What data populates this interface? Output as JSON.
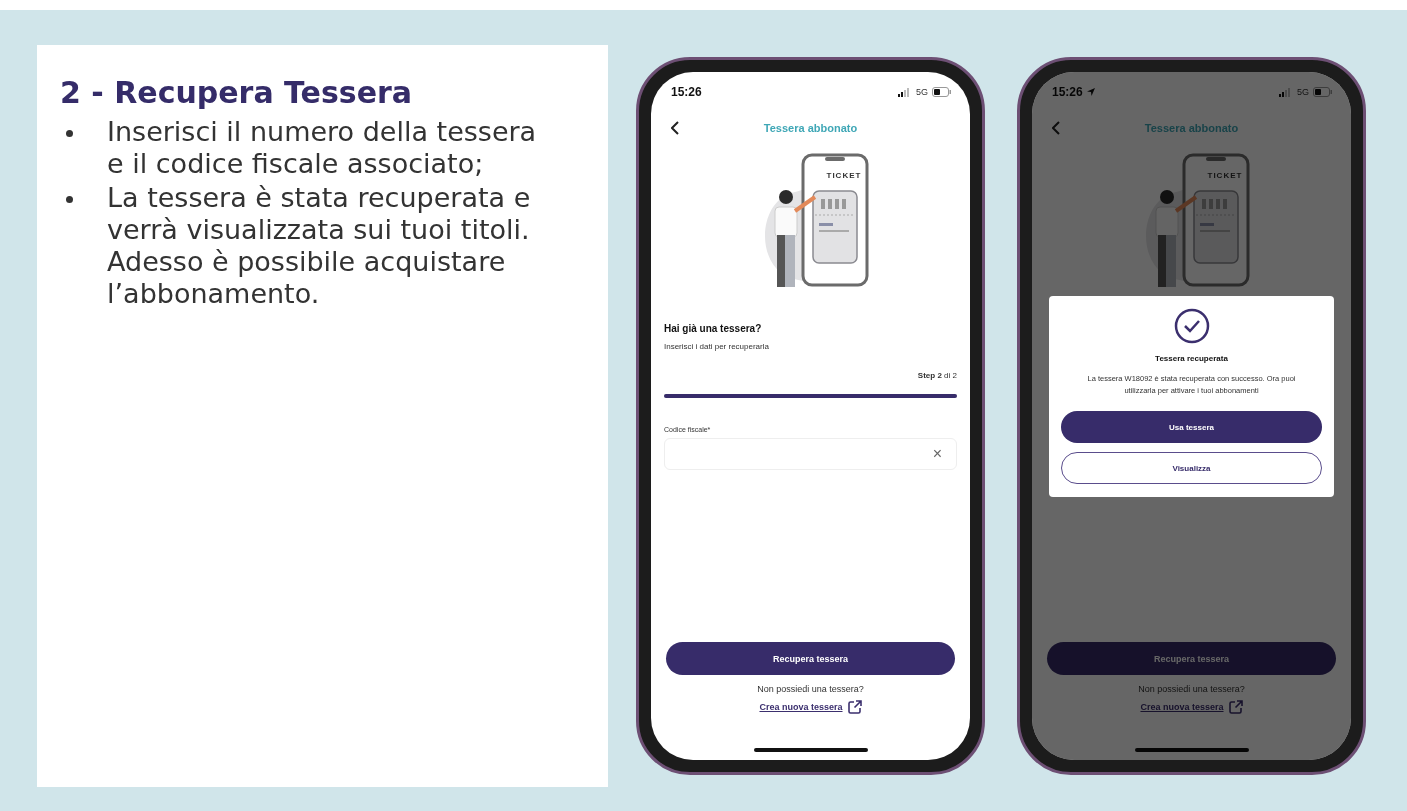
{
  "slide": {
    "title": "2 - Recupera Tessera",
    "bullets": [
      "Inserisci il numero della tessera e il codice fiscale associato;",
      "La tessera è stata recuperata e verrà visualizzata sui tuoi titoli. Adesso è possibile acquistare l’abbonamento."
    ]
  },
  "phones": [
    {
      "time": "15:26",
      "location": false,
      "network": "5G",
      "dimmed": false,
      "header_title": "Tessera abbonato",
      "ticket_label": "TICKET",
      "heading": "Hai già una tessera?",
      "subtitle": "Inserisci i dati per recuperarla",
      "step": "**Step 2** di 2",
      "progress": {
        "level": 1
      },
      "field": {
        "label": "Codice fiscale*",
        "clear": "×"
      },
      "primary_button": "Recupera tessera",
      "question": "Non possiedi una tessera?",
      "link": "Crea nuova tessera"
    },
    {
      "time": "15:26",
      "location": true,
      "network": "5G",
      "dimmed": true,
      "header_title": "Tessera abbonato",
      "ticket_label": "TICKET",
      "primary_button": "Recupera tessera",
      "question": "Non possiedi una tessera?",
      "link": "Crea nuova tessera",
      "dialog": {
        "title": "Tessera recuperata",
        "body": "La tessera W18092 è stata recuperata con successo. Ora puoi utilizzarla per attivare i tuoi abbonamenti",
        "buttons": [
          {
            "label": "Usa tessera",
            "kind": "primary"
          },
          {
            "label": "Visualizza",
            "kind": "outline"
          }
        ]
      }
    }
  ]
}
